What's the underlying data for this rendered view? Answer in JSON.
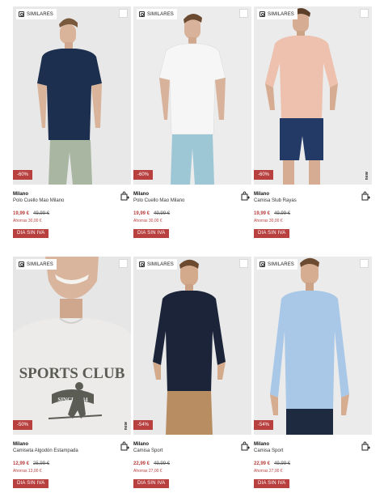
{
  "colors": {
    "accent": "#b8403f",
    "tile_bg": "#e9e9ea"
  },
  "icons": {
    "similar": "similar-search-icon",
    "wishlist": "wishlist-checkbox",
    "bag": "bag-add-icon"
  },
  "products": [
    {
      "similares": "SIMILARES",
      "discount": "-60%",
      "brand": "Milano",
      "name": "Polo Cuello Mao Milano",
      "price": "19,99 €",
      "old_price": "49,99 €",
      "savings": "Ahorras 30,00 €",
      "badge": "DIA SIN IVA",
      "side_mark": ""
    },
    {
      "similares": "SIMILARES",
      "discount": "-60%",
      "brand": "Milano",
      "name": "Polo Cuello Mao Milano",
      "price": "19,99 €",
      "old_price": "49,99 €",
      "savings": "Ahorras 30,00 €",
      "badge": "DIA SIN IVA",
      "side_mark": ""
    },
    {
      "similares": "SIMILARES",
      "discount": "-60%",
      "brand": "Milano",
      "name": "Camisa Slub Rayas",
      "price": "19,99 €",
      "old_price": "49,99 €",
      "savings": "Ahorras 30,00 €",
      "badge": "DIA SIN IVA",
      "side_mark": "new"
    },
    {
      "similares": "SIMILARES",
      "discount": "-50%",
      "brand": "Milano",
      "name": "Camiseta Algodón Estampada",
      "price": "12,99 €",
      "old_price": "25,99 €",
      "savings": "Ahorras 13,00 €",
      "badge": "DIA SIN IVA",
      "side_mark": "new"
    },
    {
      "similares": "SIMILARES",
      "discount": "-54%",
      "brand": "Milano",
      "name": "Camisa Sport",
      "price": "22,99 €",
      "old_price": "49,99 €",
      "savings": "Ahorras 27,00 €",
      "badge": "DIA SIN IVA",
      "side_mark": ""
    },
    {
      "similares": "SIMILARES",
      "discount": "-54%",
      "brand": "Milano",
      "name": "Camisa Sport",
      "price": "22,99 €",
      "old_price": "49,99 €",
      "savings": "Ahorras 27,00 €",
      "badge": "DIA SIN IVA",
      "side_mark": ""
    }
  ],
  "tee_print": {
    "line1": "SPORTS CLUB",
    "line2": "SINCE 1984"
  }
}
